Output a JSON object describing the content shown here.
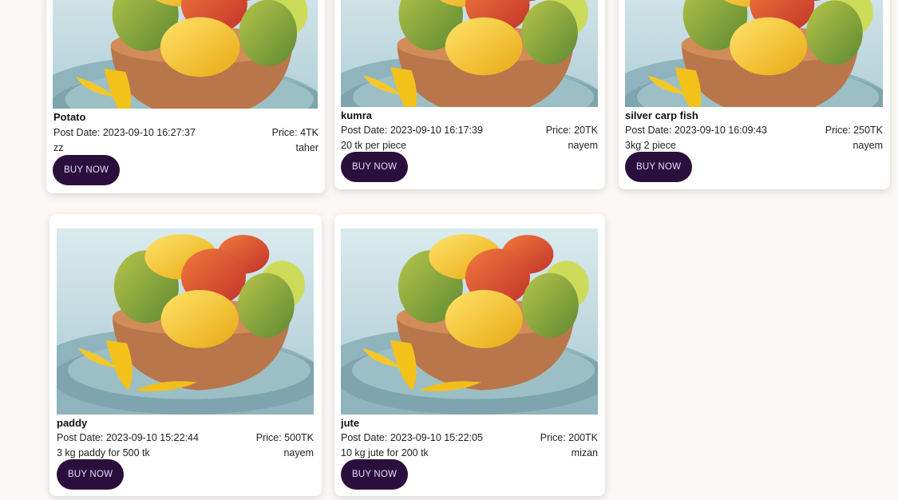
{
  "products": [
    {
      "name": "Potato",
      "post_date_label": "Post Date: 2023-09-10 16:27:37",
      "price_label": "Price: 4TK",
      "description": "zz",
      "seller": "taher",
      "button_label": "BUY NOW"
    },
    {
      "name": "kumra",
      "post_date_label": "Post Date: 2023-09-10 16:17:39",
      "price_label": "Price: 20TK",
      "description": "20 tk per piece",
      "seller": "nayem",
      "button_label": "BUY NOW"
    },
    {
      "name": "silver carp fish",
      "post_date_label": "Post Date: 2023-09-10 16:09:43",
      "price_label": "Price: 250TK",
      "description": "3kg 2 piece",
      "seller": "nayem",
      "button_label": "BUY NOW"
    },
    {
      "name": "paddy",
      "post_date_label": "Post Date: 2023-09-10 15:22:44",
      "price_label": "Price: 500TK",
      "description": "3 kg paddy for 500 tk",
      "seller": "nayem",
      "button_label": "BUY NOW"
    },
    {
      "name": "jute",
      "post_date_label": "Post Date: 2023-09-10 15:22:05",
      "price_label": "Price: 200TK",
      "description": "10 kg jute for 200 tk",
      "seller": "mizan",
      "button_label": "BUY NOW"
    }
  ],
  "product_image_icon": "mango-bowl-photo",
  "colors": {
    "button_bg": "#2a0f3d",
    "button_text": "#e6d8ff",
    "page_bg": "#fbf8f6"
  }
}
